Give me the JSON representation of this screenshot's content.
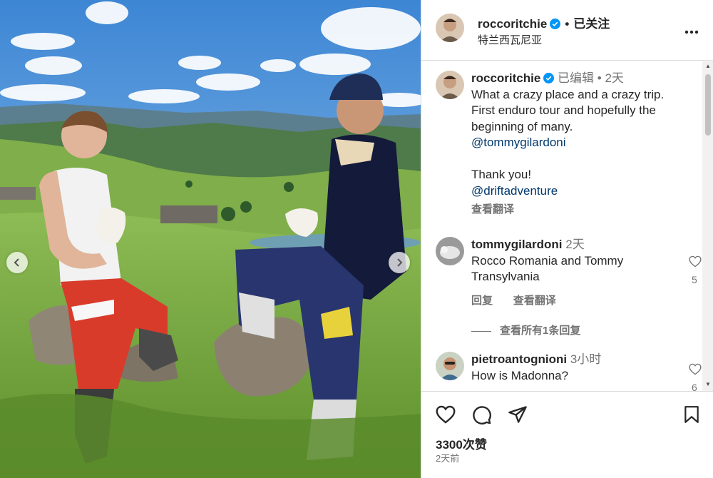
{
  "post": {
    "username": "roccoritchie",
    "follow_status": "已关注",
    "location": "特兰西瓦尼亚",
    "more_icon": "more-horizontal-icon"
  },
  "caption": {
    "username": "roccoritchie",
    "edited": "已编辑",
    "age": "2天",
    "lines": [
      "What a crazy place and a crazy trip.",
      "First enduro tour and hopefully the",
      "beginning of many."
    ],
    "mention_1": "@tommygilardoni",
    "thanks": "Thank you!",
    "mention_2": "@driftadventure",
    "translate": "查看翻译"
  },
  "comments": [
    {
      "username": "tommygilardoni",
      "age": "2天",
      "text_line_1": "Rocco Romania and Tommy",
      "text_line_2": "Transylvania",
      "reply": "回复",
      "translate": "查看翻译",
      "likes": "5",
      "view_replies": "查看所有1条回复"
    },
    {
      "username": "pietroantognioni",
      "age": "3小时",
      "text_line_1": "How is Madonna?",
      "likes": "6"
    }
  ],
  "footer": {
    "likes": "3300次赞",
    "time": "2天前"
  },
  "colors": {
    "text": "#262626",
    "secondary": "#737373",
    "link": "#00376b",
    "verified": "#0095f6",
    "border": "#dbdbdb"
  }
}
